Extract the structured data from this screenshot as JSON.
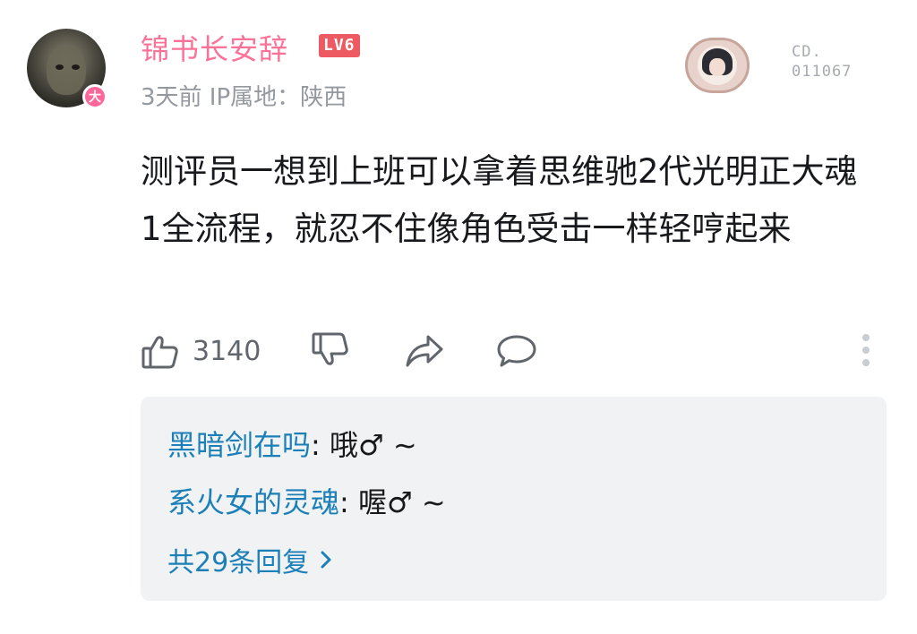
{
  "comment": {
    "username": "锦书长安辞",
    "level": "LV6",
    "avatar_badge": "大",
    "meta": "3天前 IP属地：陕西",
    "decoration_number": [
      "CD.",
      "011067"
    ],
    "text": "测评员一想到上班可以拿着思维驰2代光明正大魂1全流程，就忍不住像角色受击一样轻哼起来",
    "like_count": "3140"
  },
  "icons": {
    "like": "thumbs-up-icon",
    "dislike": "thumbs-down-icon",
    "share": "share-icon",
    "reply": "comment-bubble-icon",
    "more": "more-vertical-icon",
    "chevron": "chevron-right-icon"
  },
  "replies": {
    "items": [
      {
        "user": "黑暗剑在吗",
        "separator": ": ",
        "text": "哦♂ ~"
      },
      {
        "user": "系火女的灵魂",
        "separator": ": ",
        "text": "喔♂ ~"
      }
    ],
    "more_label": "共29条回复"
  },
  "colors": {
    "username": "#fb7299",
    "level_badge": "#ee5a62",
    "meta": "#9499a0",
    "reply_user": "#1b7fb8",
    "reply_box": "#f1f2f3"
  }
}
